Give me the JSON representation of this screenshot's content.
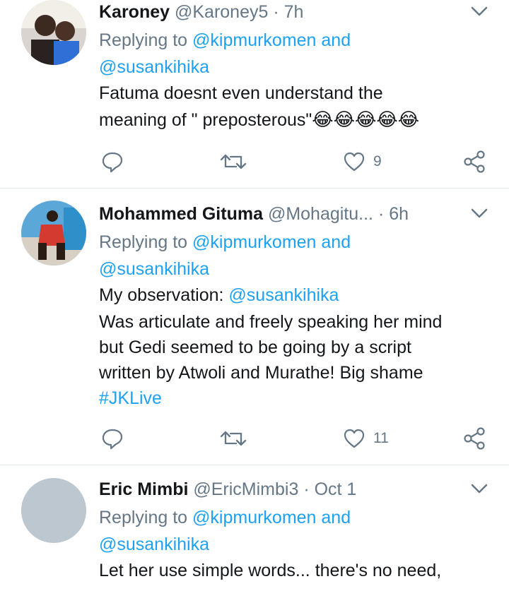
{
  "tweets": [
    {
      "name": "Karoney",
      "handle": "@Karoney5",
      "time": "· 7h",
      "reply_prefix": "Replying to",
      "reply_to_1": "@kipmurkomen and",
      "reply_to_2": "@susankihika",
      "text_1": "Fatuma doesnt  even understand the",
      "text_2": "meaning of \" preposterous\"",
      "emoji": "😂😂😂😂😂",
      "likes": "9"
    },
    {
      "name": "Mohammed Gituma",
      "handle": "@Mohagitu...",
      "time": "· 6h",
      "reply_prefix": "Replying to",
      "reply_to_1": "@kipmurkomen and",
      "reply_to_2": "@susankihika",
      "text_1a": "My observation: ",
      "text_1b": "@susankihika",
      "text_2": "Was articulate and freely speaking her mind",
      "text_3": "but Gedi seemed to be going by a script",
      "text_4": "written by Atwoli and Murathe! Big shame",
      "hashtag": "#JKLive",
      "likes": "11"
    },
    {
      "name": "Eric Mimbi",
      "handle": "@EricMimbi3",
      "time": "· Oct 1",
      "reply_prefix": "Replying to",
      "reply_to_1": "@kipmurkomen and",
      "reply_to_2": "@susankihika",
      "text_1": "Let her use simple words... there's no need,"
    }
  ],
  "icons": {
    "reply": "reply-icon",
    "retweet": "retweet-icon",
    "like": "heart-icon",
    "share": "share-icon",
    "more": "chevron-down-icon"
  },
  "colors": {
    "link": "#1da1f2",
    "meta": "#657786",
    "divider": "#e1e8ed"
  }
}
